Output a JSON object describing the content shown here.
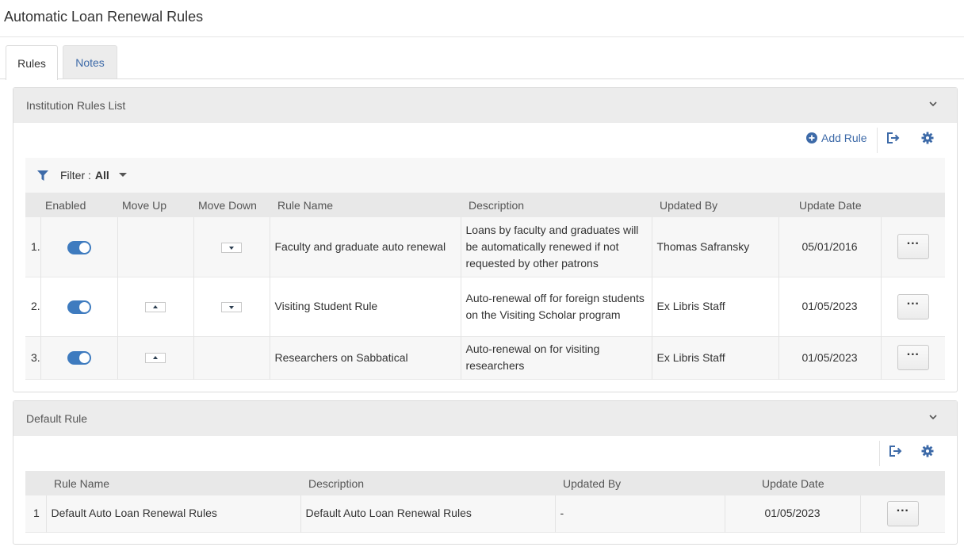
{
  "page": {
    "title": "Automatic Loan Renewal Rules"
  },
  "tabs": [
    {
      "label": "Rules",
      "active": true
    },
    {
      "label": "Notes",
      "active": false
    }
  ],
  "institution_panel": {
    "title": "Institution Rules List",
    "toolbar": {
      "add_rule_label": "Add Rule"
    },
    "filter": {
      "label": "Filter :",
      "value": "All"
    },
    "columns": [
      "Enabled",
      "Move Up",
      "Move Down",
      "Rule Name",
      "Description",
      "Updated By",
      "Update Date"
    ],
    "rows": [
      {
        "index": "1.",
        "enabled": true,
        "move_up": false,
        "move_down": true,
        "rule_name": "Faculty and graduate auto renewal",
        "description": "Loans by faculty and graduates will be automatically renewed if not requested by other patrons",
        "updated_by": "Thomas Safransky",
        "update_date": "05/01/2016",
        "actions_label": "···"
      },
      {
        "index": "2.",
        "enabled": true,
        "move_up": true,
        "move_down": true,
        "rule_name": "Visiting Student Rule",
        "description": "Auto-renewal off for foreign students on the Visiting Scholar program",
        "updated_by": "Ex Libris Staff",
        "update_date": "01/05/2023",
        "actions_label": "···"
      },
      {
        "index": "3.",
        "enabled": true,
        "move_up": true,
        "move_down": false,
        "rule_name": "Researchers on Sabbatical",
        "description": "Auto-renewal on for visiting researchers",
        "updated_by": "Ex Libris Staff",
        "update_date": "01/05/2023",
        "actions_label": "···"
      }
    ]
  },
  "default_panel": {
    "title": "Default Rule",
    "columns": [
      "Rule Name",
      "Description",
      "Updated By",
      "Update Date"
    ],
    "row": {
      "index": "1",
      "rule_name": "Default Auto Loan Renewal Rules",
      "description": "Default Auto Loan Renewal Rules",
      "updated_by": "-",
      "update_date": "01/05/2023",
      "actions_label": "···"
    }
  },
  "icons": {
    "add": "plus-circle-icon",
    "export": "export-icon",
    "settings": "gear-icon",
    "filter": "funnel-icon",
    "collapse": "chevron-down-icon",
    "dropdown": "caret-down-icon"
  },
  "colors": {
    "accent": "#3d6aa8",
    "toggle_on": "#3e7bbf"
  }
}
